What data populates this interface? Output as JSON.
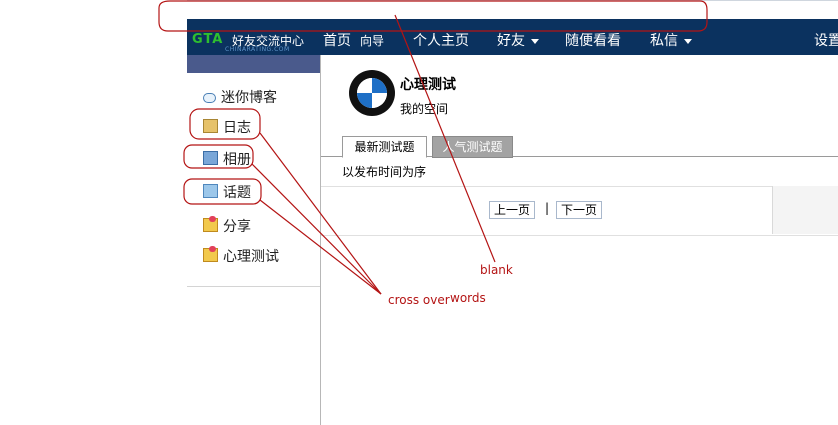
{
  "logo": {
    "mark": "GTA",
    "name": "好友交流中心",
    "sub": "CHINARATING.COM"
  },
  "nav": {
    "home": "首页",
    "guide": "向导",
    "profile": "个人主页",
    "friends": "好友",
    "browse": "随便看看",
    "messages": "私信",
    "settings": "设置"
  },
  "sidebar": {
    "items": [
      {
        "label": "迷你博客",
        "icon": "speech-bubble-icon"
      },
      {
        "label": "日志",
        "icon": "journal-icon"
      },
      {
        "label": "相册",
        "icon": "photo-album-icon"
      },
      {
        "label": "话题",
        "icon": "topic-icon"
      },
      {
        "label": "分享",
        "icon": "share-icon"
      },
      {
        "label": "心理测试",
        "icon": "quiz-icon"
      }
    ]
  },
  "main": {
    "title": "心理测试",
    "subtitle": "我的空间",
    "avatar": "bmw-logo-avatar",
    "tabs": [
      {
        "label": "最新测试题",
        "active": true
      },
      {
        "label": "人气测试题",
        "active": false
      }
    ],
    "order_text": "以发布时间为序",
    "pager": {
      "prev": "上一页",
      "separator": "|",
      "next": "下一页"
    }
  },
  "annotations": {
    "blank": "blank",
    "cross_over": "cross over",
    "words": "words",
    "color": "#b41414"
  },
  "colors": {
    "navbar": "#0b325f",
    "sidebar_strip": "#4a5a8c",
    "inactive_tab": "#a3a3a3"
  }
}
